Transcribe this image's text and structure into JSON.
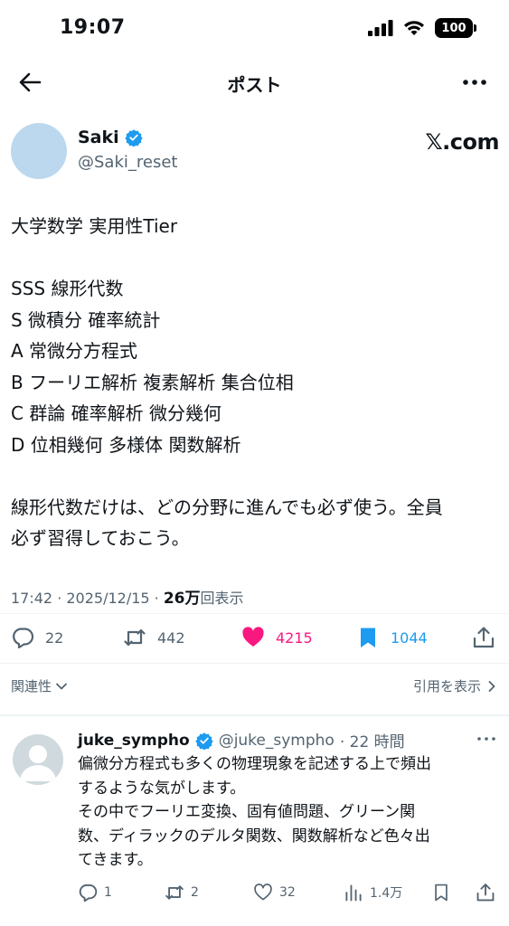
{
  "status_bar": {
    "time": "19:07",
    "battery": "100"
  },
  "nav": {
    "title": "ポスト"
  },
  "author": {
    "name": "Saki",
    "handle": "@Saki_reset",
    "brand": "𝕏.com"
  },
  "post": {
    "lines": [
      "大学数学 実用性Tier",
      "",
      "SSS 線形代数",
      "S 微積分 確率統計",
      "A 常微分方程式",
      "B フーリエ解析 複素解析 集合位相",
      "C 群論 確率解析 微分幾何",
      "D 位相幾何 多様体 関数解析",
      "",
      "線形代数だけは、どの分野に進んでも必ず使う。全員",
      "必ず習得しておこう。"
    ],
    "timestamp": "17:42 · 2025/12/15 · ",
    "views_count": "26万",
    "views_label": "回表示"
  },
  "actions": {
    "replies": "22",
    "reposts": "442",
    "likes": "4215",
    "bookmarks": "1044"
  },
  "sort": {
    "label": "関連性",
    "quotes_label": "引用を表示"
  },
  "reply": {
    "name": "juke_sympho",
    "handle": "@juke_sympho",
    "time": "· 22 時間",
    "lines": [
      "偏微分方程式も多くの物理現象を記述する上で頻出",
      "するような気がします。",
      "その中でフーリエ変換、固有値問題、グリーン関",
      "数、ディラックのデルタ関数、関数解析など色々出",
      "てきます。"
    ],
    "replies": "1",
    "reposts": "2",
    "likes": "32",
    "views": "1.4万"
  },
  "colors": {
    "text": "#0f1419",
    "muted": "#536471",
    "verified": "#1d9bf0",
    "like": "#f91880",
    "bookmark": "#1d9bf0"
  },
  "icons": [
    "back-arrow-icon",
    "more-icon",
    "verified-icon",
    "reply-icon",
    "repost-icon",
    "heart-icon",
    "bookmark-icon",
    "share-icon",
    "chevron-down-icon",
    "chevron-right-icon",
    "views-icon"
  ]
}
